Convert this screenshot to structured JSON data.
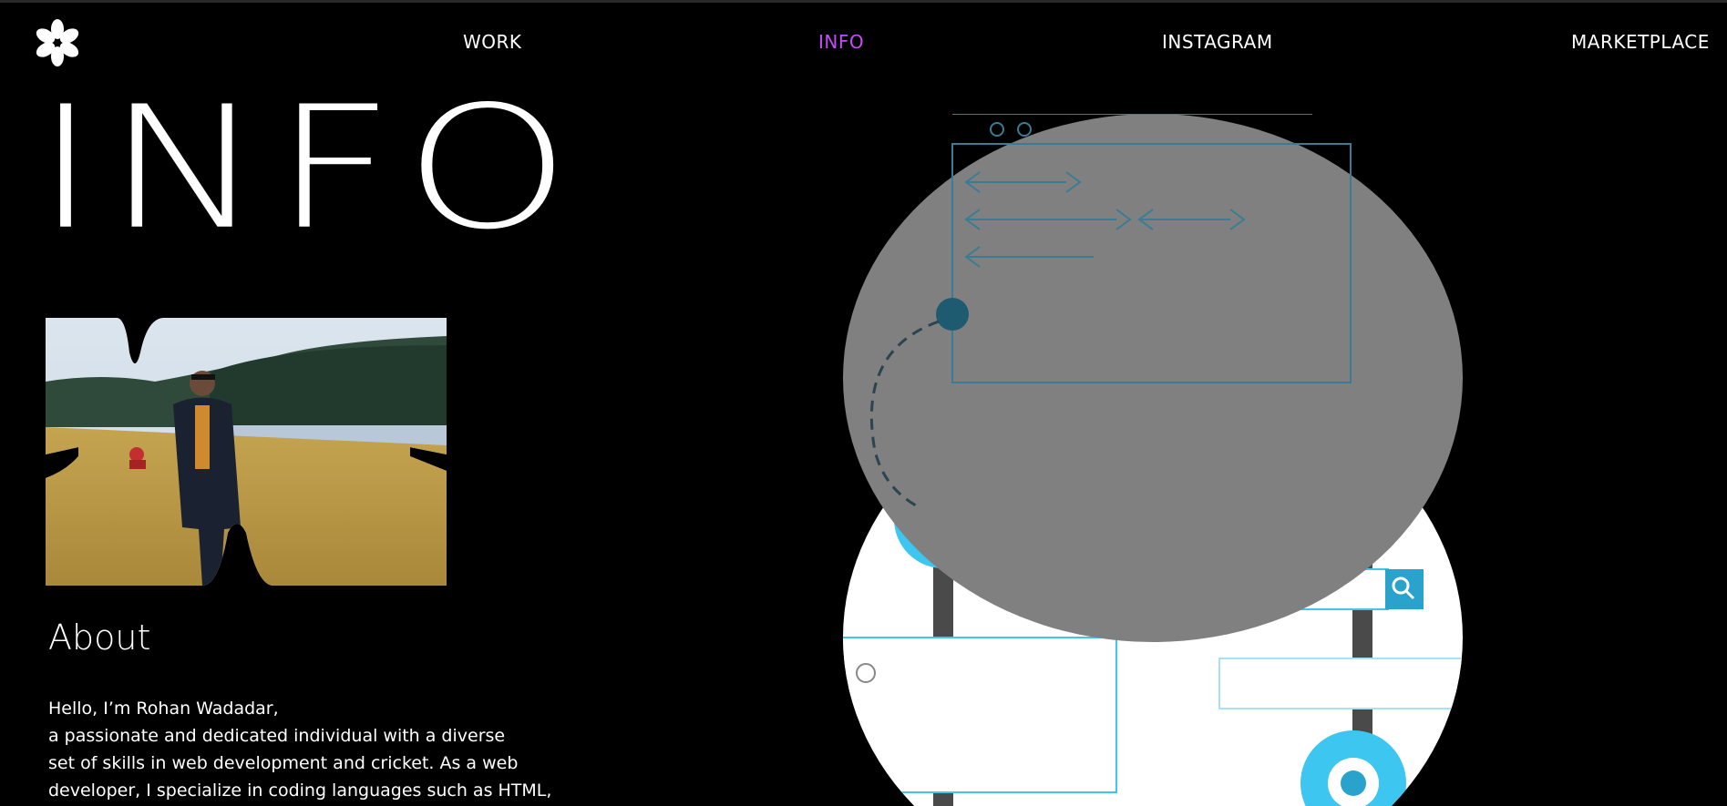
{
  "nav": {
    "work": "WORK",
    "info": "INFO",
    "instagram": "INSTAGRAM",
    "marketplace": "MARKETPLACE",
    "active_color": "#c64cf5"
  },
  "hero": {
    "title": "INFO"
  },
  "about": {
    "heading": "About",
    "lines": [
      "Hello, I’m Rohan Wadadar,",
      "a passionate and dedicated individual with a diverse",
      "set of skills in web development and cricket. As a web",
      "developer, I specialize in coding languages such as HTML,"
    ]
  },
  "colors": {
    "background": "#000000",
    "accent_blue": "#3cc6f0",
    "gray": "#808080"
  },
  "icons": {
    "logo": "flower-asterisk-icon",
    "code": "code-brackets-icon",
    "search": "search-icon",
    "gear": "gear-icon"
  }
}
